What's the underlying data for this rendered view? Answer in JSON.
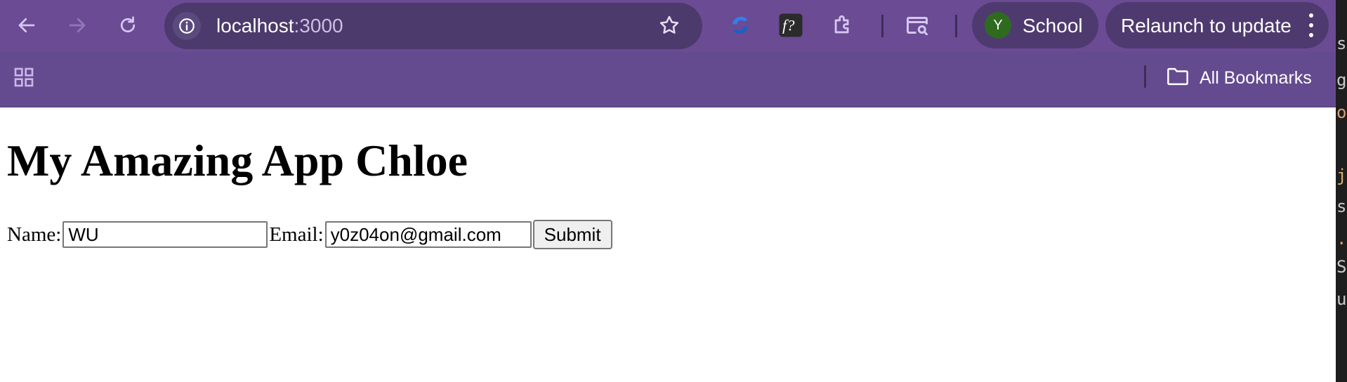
{
  "browser": {
    "url_host": "localhost",
    "url_port": ":3000",
    "profile": {
      "initial": "Y",
      "name": "School"
    },
    "relaunch_label": "Relaunch to update",
    "bookmarks_label": "All Bookmarks",
    "colors": {
      "toolbar": "#6a4b94",
      "omnibox": "#4b3a6b",
      "chip": "#4e3a6f",
      "avatar": "#2f6b1e"
    },
    "icons": [
      "back-arrow-icon",
      "forward-arrow-icon",
      "reload-icon",
      "info-icon",
      "star-icon",
      "extension-swirl-icon",
      "extension-fx-icon",
      "extensions-puzzle-icon",
      "tab-search-icon",
      "menu-kebab-icon",
      "apps-grid-icon",
      "folder-icon"
    ]
  },
  "page": {
    "title": "My Amazing App Chloe",
    "form": {
      "name_label": "Name:",
      "name_value": "WU",
      "email_label": "Email:",
      "email_value": "y0z04on@gmail.com",
      "submit_label": "Submit"
    }
  },
  "sliver_text": [
    "s",
    "g",
    "ou",
    "js",
    "s",
    ".r",
    "S",
    "u"
  ]
}
